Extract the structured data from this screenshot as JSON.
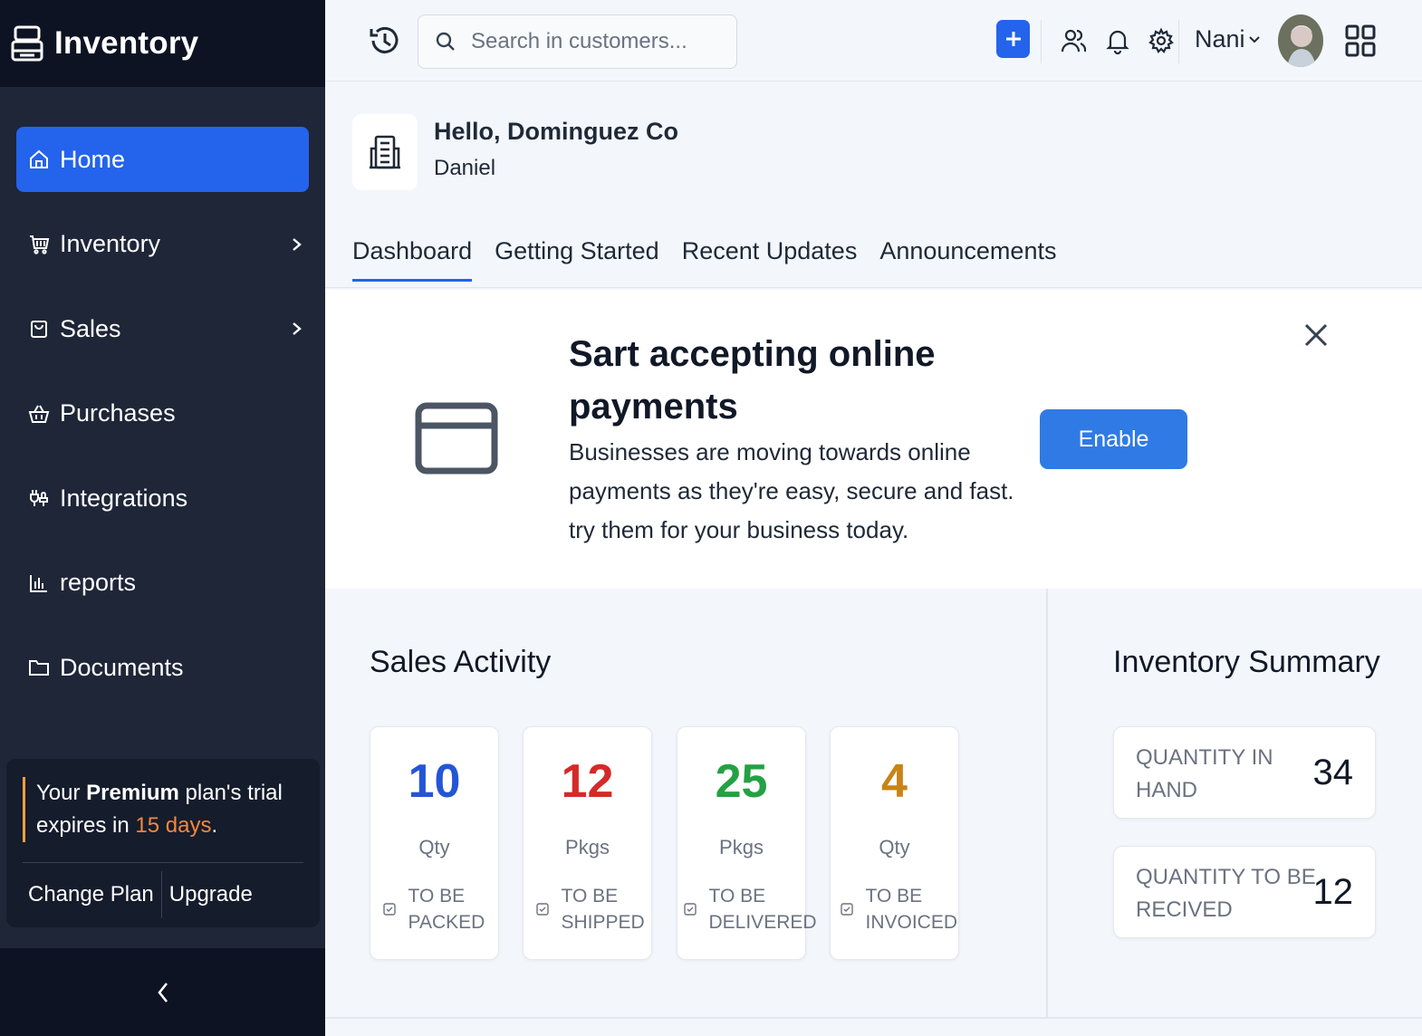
{
  "app": {
    "title": "Inventory"
  },
  "sidebar": {
    "items": [
      {
        "label": "Home",
        "icon": "home-icon",
        "active": true
      },
      {
        "label": "Inventory",
        "icon": "cart-icon",
        "has_submenu": true
      },
      {
        "label": "Sales",
        "icon": "shopping-bag-icon",
        "has_submenu": true
      },
      {
        "label": "Purchases",
        "icon": "basket-icon"
      },
      {
        "label": "Integrations",
        "icon": "plug-icon"
      },
      {
        "label": "reports",
        "icon": "bar-chart-icon"
      },
      {
        "label": "Documents",
        "icon": "folder-icon"
      }
    ],
    "trial": {
      "prefix": "Your ",
      "plan": "Premium",
      "mid": " plan's trial expires in ",
      "days": "15 days",
      "suffix": ".",
      "change_plan": "Change Plan",
      "upgrade": "Upgrade"
    }
  },
  "topbar": {
    "search_placeholder": "Search in customers...",
    "user_name": "Nani"
  },
  "greeting": {
    "hello": "Hello, Dominguez Co",
    "user": "Daniel"
  },
  "tabs": [
    {
      "label": "Dashboard",
      "active": true
    },
    {
      "label": "Getting Started"
    },
    {
      "label": "Recent Updates"
    },
    {
      "label": "Announcements"
    }
  ],
  "banner": {
    "title": "Sart accepting online payments",
    "body": "Businesses are moving towards online payments as they're easy, secure and fast. try them for your business today.",
    "button": "Enable"
  },
  "sales_activity": {
    "title": "Sales Activity",
    "cards": [
      {
        "value": "10",
        "unit": "Qty",
        "label": "TO BE PACKED",
        "color": "#2455d6"
      },
      {
        "value": "12",
        "unit": "Pkgs",
        "label": "TO BE SHIPPED",
        "color": "#d42a2a"
      },
      {
        "value": "25",
        "unit": "Pkgs",
        "label": "TO BE DELIVERED",
        "color": "#24a143"
      },
      {
        "value": "4",
        "unit": "Qty",
        "label": "TO BE INVOICED",
        "color": "#c88417"
      }
    ]
  },
  "inventory_summary": {
    "title": "Inventory Summary",
    "cards": [
      {
        "label": "QUANTITY IN HAND",
        "value": "34"
      },
      {
        "label": "QUANTITY TO BE RECIVED",
        "value": "12"
      }
    ]
  },
  "colors": {
    "primary": "#2463eb",
    "sidebar": "#1e2638",
    "sidebar_dark": "#0d1322",
    "accent": "#f5873b"
  }
}
